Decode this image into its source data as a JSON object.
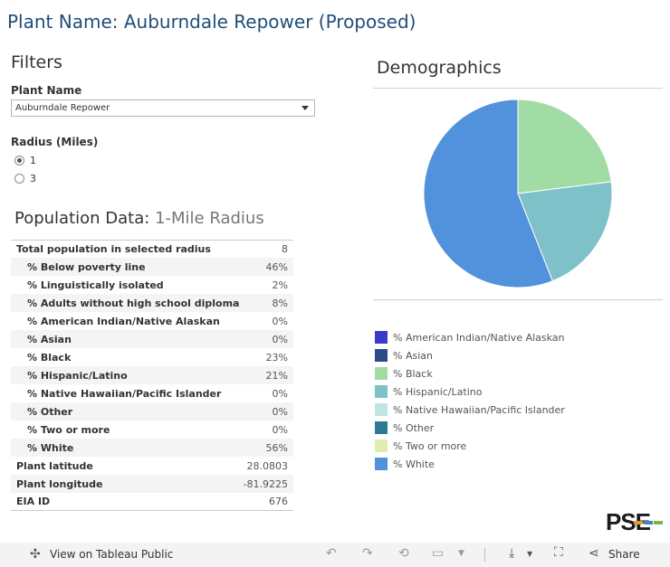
{
  "page": {
    "title": "Plant Name: Auburndale Repower (Proposed)"
  },
  "filters": {
    "heading": "Filters",
    "plant_name_label": "Plant Name",
    "plant_name_value": "Auburndale Repower",
    "radius_label": "Radius (Miles)",
    "radius_options": [
      {
        "label": "1",
        "selected": true
      },
      {
        "label": "3",
        "selected": false
      }
    ]
  },
  "population": {
    "heading_main": "Population Data:",
    "heading_sub": "1-Mile Radius",
    "rows": [
      {
        "label": "Total population in selected radius",
        "value": "8"
      },
      {
        "label": "% Below poverty line",
        "value": "46%"
      },
      {
        "label": "% Linguistically isolated",
        "value": "2%"
      },
      {
        "label": "% Adults without high school diploma",
        "value": "8%"
      },
      {
        "label": "% American Indian/Native Alaskan",
        "value": "0%"
      },
      {
        "label": "% Asian",
        "value": "0%"
      },
      {
        "label": "% Black",
        "value": "23%"
      },
      {
        "label": "% Hispanic/Latino",
        "value": "21%"
      },
      {
        "label": "% Native Hawaiian/Pacific Islander",
        "value": "0%"
      },
      {
        "label": "% Other",
        "value": "0%"
      },
      {
        "label": "% Two or more",
        "value": "0%"
      },
      {
        "label": "% White",
        "value": "56%"
      },
      {
        "label": "Plant latitude",
        "value": "28.0803"
      },
      {
        "label": "Plant longitude",
        "value": "-81.9225"
      },
      {
        "label": "EIA ID",
        "value": "676"
      }
    ]
  },
  "demographics": {
    "heading": "Demographics",
    "legend": [
      {
        "label": "% American Indian/Native Alaskan",
        "color": "#3b3bc9"
      },
      {
        "label": "% Asian",
        "color": "#2b4a87"
      },
      {
        "label": "% Black",
        "color": "#a2dca5"
      },
      {
        "label": "% Hispanic/Latino",
        "color": "#7fc1c9"
      },
      {
        "label": "% Native Hawaiian/Pacific Islander",
        "color": "#bfe6e4"
      },
      {
        "label": "% Other",
        "color": "#2f7a93"
      },
      {
        "label": "% Two or more",
        "color": "#dfeeb0"
      },
      {
        "label": "% White",
        "color": "#5291db"
      }
    ]
  },
  "chart_data": {
    "type": "pie",
    "categories": [
      "% American Indian/Native Alaskan",
      "% Asian",
      "% Black",
      "% Hispanic/Latino",
      "% Native Hawaiian/Pacific Islander",
      "% Other",
      "% Two or more",
      "% White"
    ],
    "values": [
      0,
      0,
      23,
      21,
      0,
      0,
      0,
      56
    ],
    "colors": [
      "#3b3bc9",
      "#2b4a87",
      "#a2dca5",
      "#7fc1c9",
      "#bfe6e4",
      "#2f7a93",
      "#dfeeb0",
      "#5291db"
    ],
    "legend_position": "bottom"
  },
  "brand": {
    "logo_text": "PSE"
  },
  "footer": {
    "view_label": "View on Tableau Public",
    "share_label": "Share"
  }
}
